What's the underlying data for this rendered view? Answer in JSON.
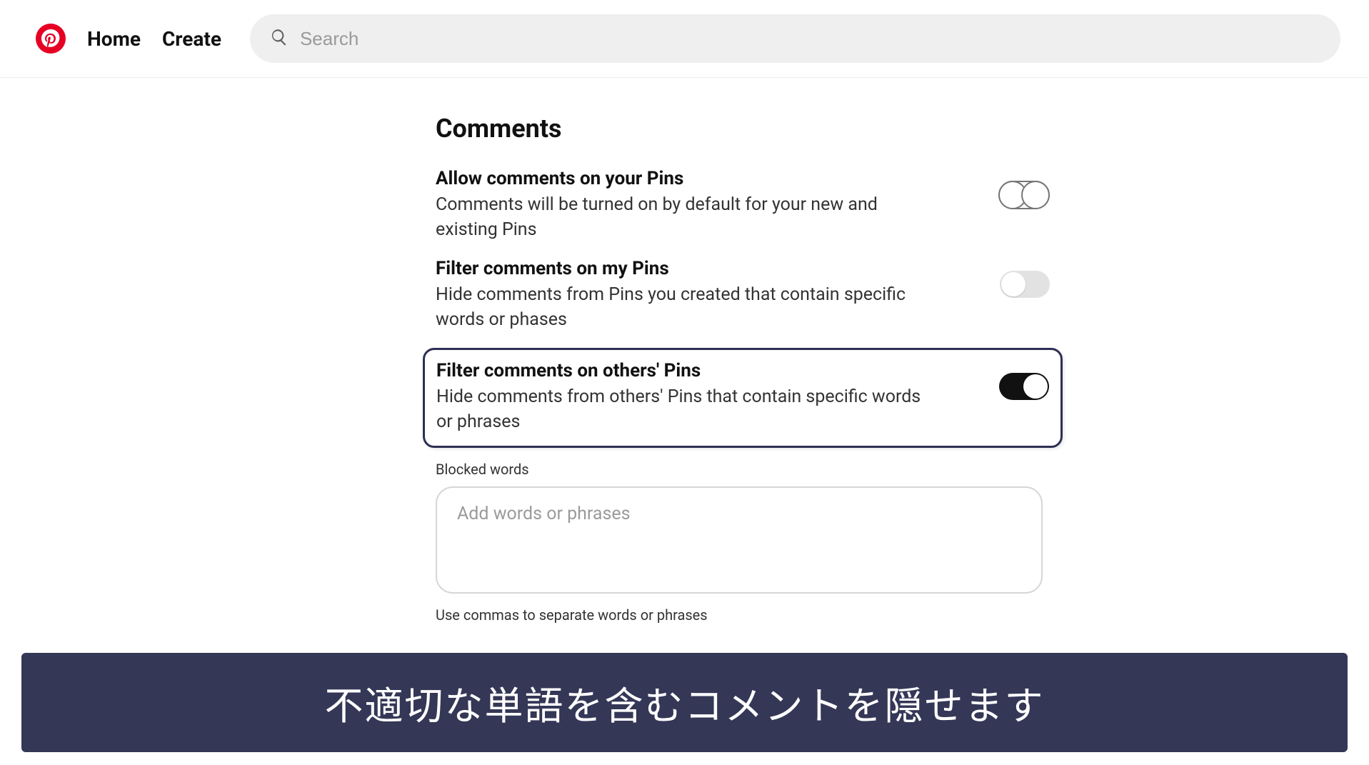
{
  "header": {
    "home_label": "Home",
    "create_label": "Create",
    "search_placeholder": "Search"
  },
  "comments": {
    "section_title": "Comments",
    "allow": {
      "label": "Allow comments on your Pins",
      "desc": "Comments will be turned on by default for your new and existing Pins",
      "on": false
    },
    "filter_my": {
      "label": "Filter comments on my Pins",
      "desc": "Hide comments from Pins you created that contain specific words or phases",
      "on": false
    },
    "filter_others": {
      "label": "Filter comments on others' Pins",
      "desc": "Hide comments from others' Pins that contain specific words or phrases",
      "on": true
    },
    "blocked_words_label": "Blocked words",
    "blocked_words_placeholder": "Add words or phrases",
    "blocked_words_helper": "Use commas to separate words or phrases"
  },
  "caption": "不適切な単語を含むコメントを隠せます"
}
